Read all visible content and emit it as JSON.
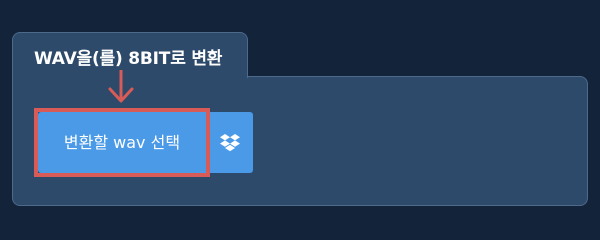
{
  "panel": {
    "title": "WAV을(를) 8BIT로 변환"
  },
  "upload": {
    "select_button_label": "변환할 wav 선택",
    "cloud_button_icon": "dropbox-icon"
  },
  "colors": {
    "page_background": "#12233a",
    "panel_background": "#2d4a6a",
    "button_blue": "#4a9ae8",
    "highlight_red": "#d95b57"
  }
}
